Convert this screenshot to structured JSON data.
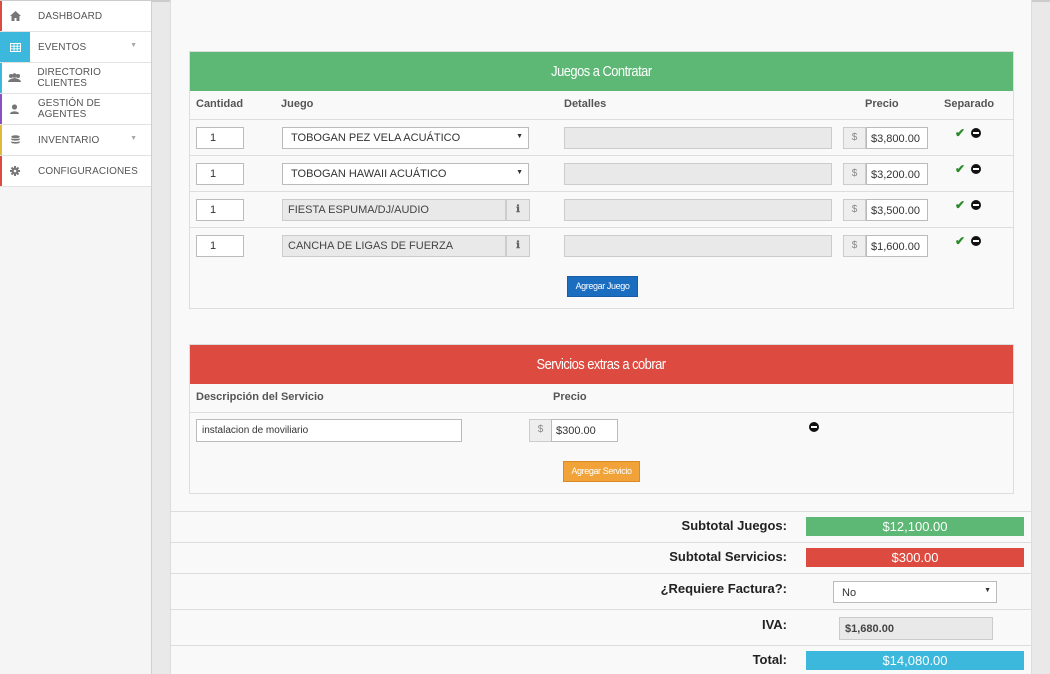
{
  "sidebar": {
    "items": [
      {
        "label": "DASHBOARD",
        "icon": "home-icon",
        "glyph": "⌂"
      },
      {
        "label": "EVENTOS",
        "icon": "table-icon",
        "glyph": "▦"
      },
      {
        "label": "DIRECTORIO CLIENTES",
        "icon": "users-icon",
        "glyph": "👥"
      },
      {
        "label": "GESTIÓN DE AGENTES",
        "icon": "user-icon",
        "glyph": "●"
      },
      {
        "label": "INVENTARIO",
        "icon": "database-icon",
        "glyph": "≡"
      },
      {
        "label": "CONFIGURACIONES",
        "icon": "gear-icon",
        "glyph": "⚙"
      }
    ]
  },
  "juegos": {
    "title": "Juegos a Contratar",
    "headers": {
      "cantidad": "Cantidad",
      "juego": "Juego",
      "detalles": "Detalles",
      "precio": "Precio",
      "separado": "Separado"
    },
    "rows": [
      {
        "qty": "1",
        "game": "TOBOGAN PEZ VELA ACUÁTICO",
        "type": "select",
        "currency": "$",
        "price": "$3,800.00"
      },
      {
        "qty": "1",
        "game": "TOBOGAN HAWAII ACUÁTICO",
        "type": "select",
        "currency": "$",
        "price": "$3,200.00"
      },
      {
        "qty": "1",
        "game": "FIESTA ESPUMA/DJ/AUDIO",
        "type": "readonly",
        "currency": "$",
        "price": "$3,500.00"
      },
      {
        "qty": "1",
        "game": "CANCHA DE LIGAS DE FUERZA",
        "type": "readonly",
        "currency": "$",
        "price": "$1,600.00"
      }
    ],
    "add_label": "Agregar Juego"
  },
  "servicios": {
    "title": "Servicios extras a cobrar",
    "headers": {
      "descripcion": "Descripción del Servicio",
      "precio": "Precio"
    },
    "rows": [
      {
        "desc": "instalacion de moviliario",
        "currency": "$",
        "price": "$300.00"
      }
    ],
    "add_label": "Agregar Servicio"
  },
  "totals": {
    "subtotal_juegos_label": "Subtotal Juegos:",
    "subtotal_juegos": "$12,100.00",
    "subtotal_servicios_label": "Subtotal Servicios:",
    "subtotal_servicios": "$300.00",
    "factura_label": "¿Requiere Factura?:",
    "factura_value": "No",
    "iva_label": "IVA:",
    "iva_value": "$1,680.00",
    "total_label": "Total:",
    "total_value": "$14,080.00"
  },
  "colors": {
    "green": "#5cb874",
    "red": "#dd4b40",
    "blue": "#3cb8dc",
    "active": "#3cb8dc"
  }
}
